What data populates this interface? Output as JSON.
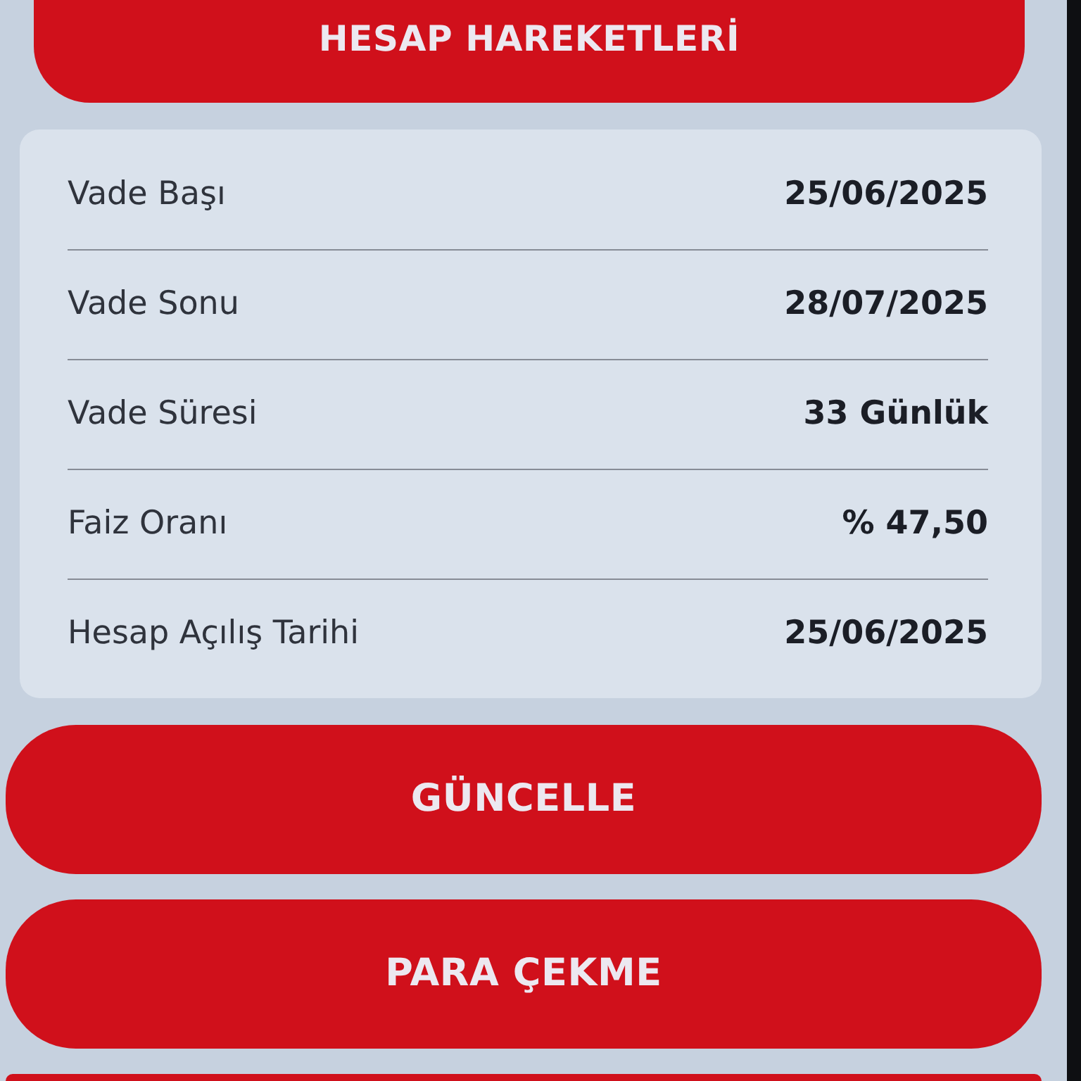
{
  "top_button": {
    "label": "HESAP HAREKETLERİ"
  },
  "details": [
    {
      "label": "Vade Başı",
      "value": "25/06/2025"
    },
    {
      "label": "Vade Sonu",
      "value": "28/07/2025"
    },
    {
      "label": "Vade Süresi",
      "value": "33 Günlük"
    },
    {
      "label": "Faiz Oranı",
      "value": "% 47,50"
    },
    {
      "label": "Hesap Açılış Tarihi",
      "value": "25/06/2025"
    }
  ],
  "actions": [
    {
      "label": "GÜNCELLE"
    },
    {
      "label": "PARA ÇEKME"
    }
  ],
  "more_below": true
}
